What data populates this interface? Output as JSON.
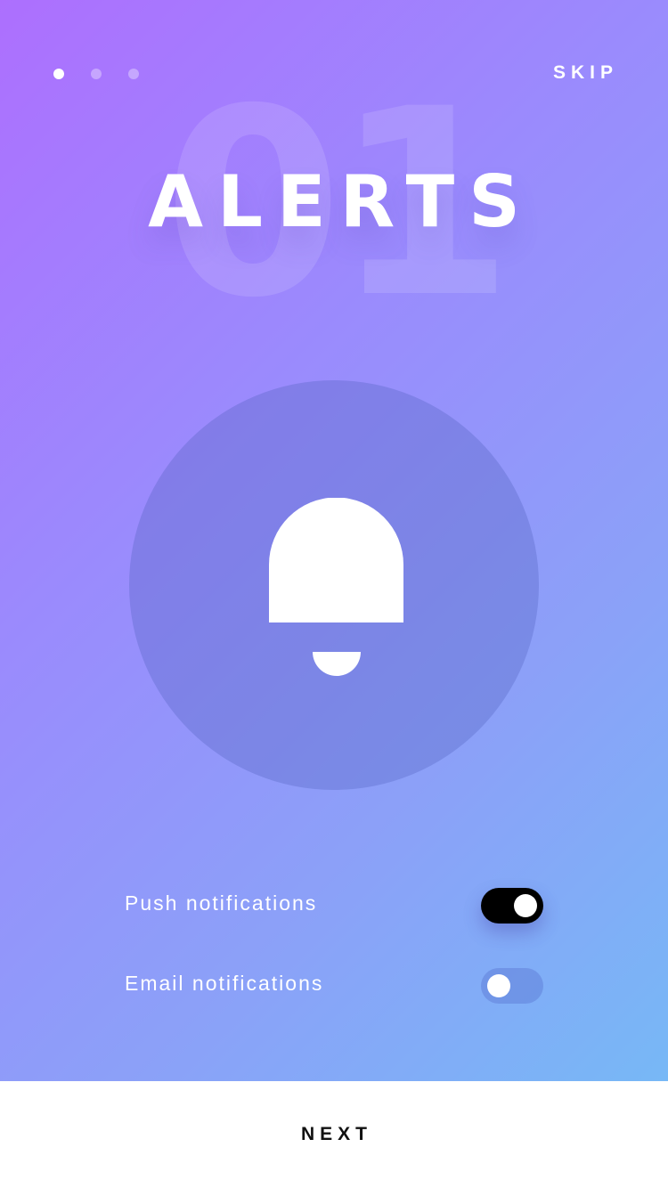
{
  "pager": {
    "count": 3,
    "active_index": 0
  },
  "header": {
    "skip_label": "SKIP"
  },
  "hero": {
    "step_number": "01",
    "title": "ALERTS",
    "icon": "bell-icon"
  },
  "settings": [
    {
      "label": "Push notifications",
      "enabled": true
    },
    {
      "label": "Email notifications",
      "enabled": false
    }
  ],
  "footer": {
    "next_label": "NEXT"
  },
  "colors": {
    "gradient_start": "#ad6ffe",
    "gradient_end": "#77b8f6",
    "toggle_on": "#000000",
    "footer_bg": "#ffffff"
  }
}
